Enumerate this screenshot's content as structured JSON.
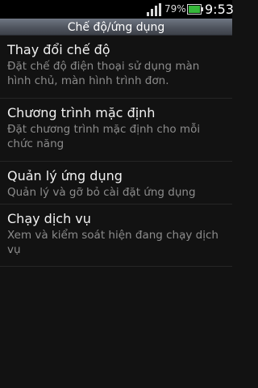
{
  "status_bar": {
    "battery_percent": "79%",
    "time": "9:53",
    "icons": [
      "signal-icon",
      "battery-icon"
    ]
  },
  "title_bar": {
    "title": "Chế độ/ứng dụng"
  },
  "list": {
    "items": [
      {
        "title": "Thay đổi chế độ",
        "summary": "Đặt chế độ điện thoại sử dụng màn hình chủ, màn hình trình đơn."
      },
      {
        "title": "Chương trình mặc định",
        "summary": "Đặt chương trình mặc định cho mỗi chức năng"
      },
      {
        "title": "Quản lý ứng dụng",
        "summary": "Quản lý và gỡ bỏ cài đặt ứng dụng"
      },
      {
        "title": "Chạy dịch vụ",
        "summary": "Xem và kiểm soát hiện đang chạy dịch vụ"
      }
    ]
  },
  "colors": {
    "background": "#121212",
    "title_text": "#f2f2f2",
    "summary_text": "#8c8c8c",
    "battery_green": "#36b73a"
  }
}
